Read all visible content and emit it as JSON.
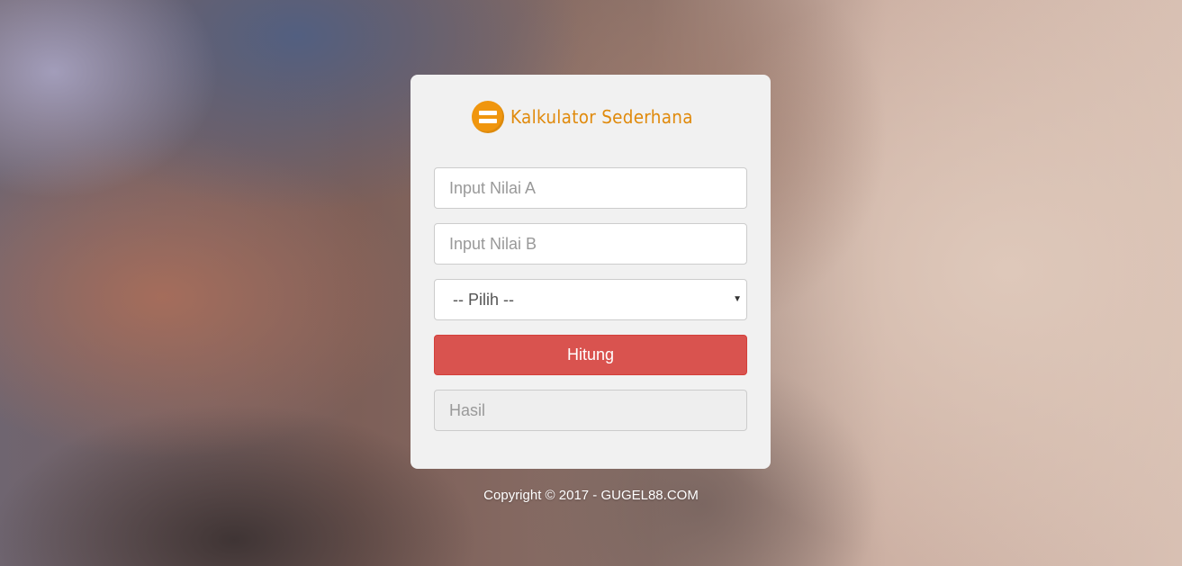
{
  "app": {
    "title": "Kalkulator Sederhana"
  },
  "form": {
    "input_a_placeholder": "Input Nilai A",
    "input_b_placeholder": "Input Nilai B",
    "operator_selected": "-- Pilih --",
    "submit_label": "Hitung",
    "result_placeholder": "Hasil"
  },
  "footer": {
    "copyright": "Copyright © 2017 - GUGEL88.COM"
  },
  "icons": {
    "logo": "equals-icon",
    "select_caret": "caret-down-icon"
  },
  "colors": {
    "brand": "#e08a0c",
    "logo": "#f0960e",
    "button": "#d9534f",
    "card": "#f1f1f1"
  }
}
